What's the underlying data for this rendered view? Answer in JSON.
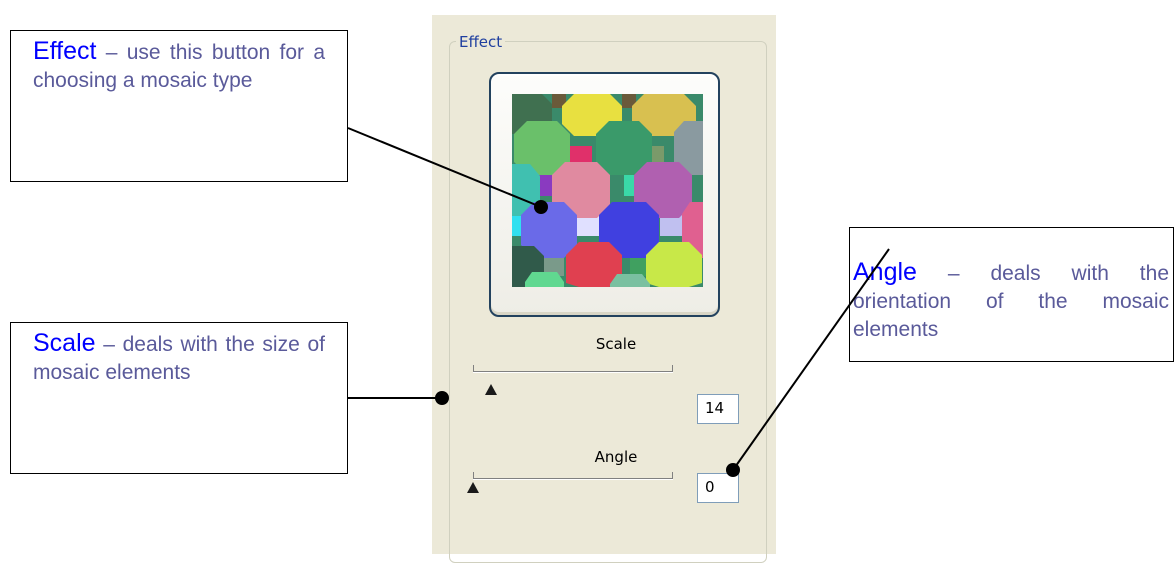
{
  "panel": {
    "group_label": "Effect",
    "effect_button": {
      "icon": "octagon-mosaic-preview"
    },
    "scale": {
      "label": "Scale",
      "value": "14",
      "level": 0.03
    },
    "angle": {
      "label": "Angle",
      "value": "0",
      "level": 0.0
    }
  },
  "callouts": {
    "effect": {
      "keyword": "Effect",
      "text": " – use this button for a choosing a mosaic type"
    },
    "scale": {
      "keyword": "Scale",
      "text": " – deals with the size of mosaic elements"
    },
    "angle": {
      "keyword": "Angle",
      "text": " – deals with the orientation of the mosaic elements"
    }
  },
  "colors": {
    "keyword": "#0000ff",
    "callout_text": "#5a5a9a",
    "panel_bg": "#ece9d8",
    "group_label": "#1f3f9f"
  }
}
